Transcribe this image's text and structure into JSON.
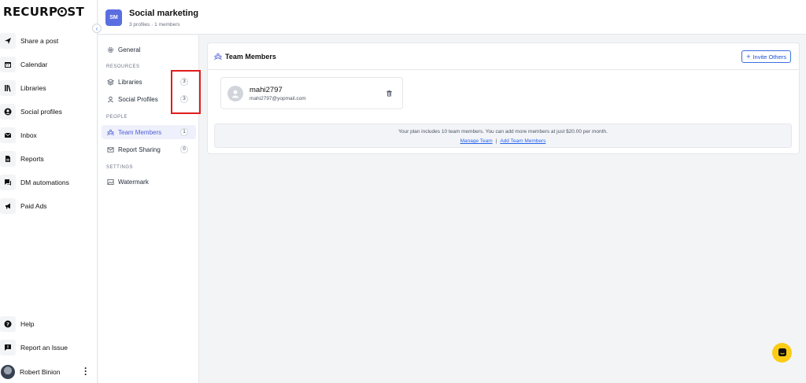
{
  "brand": {
    "logo_text_a": "RECURP",
    "logo_text_b": "ST"
  },
  "nav": {
    "items": [
      {
        "label": "Share a post",
        "icon": "send-icon"
      },
      {
        "label": "Calendar",
        "icon": "calendar-icon"
      },
      {
        "label": "Libraries",
        "icon": "libraries-icon"
      },
      {
        "label": "Social profiles",
        "icon": "profile-icon"
      },
      {
        "label": "Inbox",
        "icon": "inbox-icon"
      },
      {
        "label": "Reports",
        "icon": "reports-icon"
      },
      {
        "label": "DM automations",
        "icon": "chat-icon"
      },
      {
        "label": "Paid Ads",
        "icon": "megaphone-icon"
      }
    ],
    "bottom": [
      {
        "label": "Help",
        "icon": "help-icon"
      },
      {
        "label": "Report an Issue",
        "icon": "report-icon"
      }
    ],
    "user_name": "Robert Binion"
  },
  "workspace": {
    "initials": "SM",
    "title": "Social marketing",
    "subtitle": "3 profiles · 1 members"
  },
  "settings_menu": {
    "general": "General",
    "section_resources": "RESOURCES",
    "libraries": {
      "label": "Libraries",
      "count": "3"
    },
    "social_profiles": {
      "label": "Social Profiles",
      "count": "3"
    },
    "section_people": "PEOPLE",
    "team_members": {
      "label": "Team Members",
      "count": "1"
    },
    "report_sharing": {
      "label": "Report Sharing",
      "count": "0"
    },
    "section_settings": "SETTINGS",
    "watermark": "Watermark"
  },
  "panel": {
    "title": "Team Members",
    "invite_label": "Invite Others",
    "member": {
      "name": "mahi2797",
      "email": "mahi2797@yopmail.com"
    },
    "plan_text": "Your plan includes 10 team members. You can add more members at just $20.00 per month.",
    "manage_link": "Manage Team",
    "separator": "|",
    "add_link": "Add Team Members"
  },
  "colors": {
    "accent": "#4f5fd6",
    "highlight": "#e11d1d",
    "chat": "#facc15"
  }
}
